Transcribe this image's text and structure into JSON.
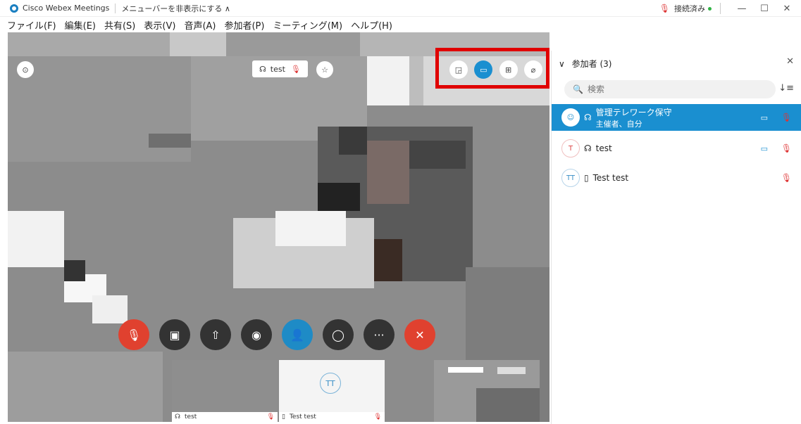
{
  "titlebar": {
    "app_title": "Cisco Webex Meetings",
    "hide_menu": "メニューバーを非表示にする ∧",
    "connection_status": "接続済み",
    "status_color": "#2fb344"
  },
  "menu": {
    "items": [
      "ファイル(F)",
      "編集(E)",
      "共有(S)",
      "表示(V)",
      "音声(A)",
      "参加者(P)",
      "ミーティング(M)",
      "ヘルプ(H)"
    ]
  },
  "stage": {
    "speaker_label": "test",
    "layout_buttons": [
      "floating",
      "stage",
      "grid",
      "pin"
    ],
    "active_layout": "stage"
  },
  "controls": {
    "items": [
      {
        "name": "mute-button",
        "icon": "mic-off-icon",
        "glyph": "🎙",
        "color": "#e0412f"
      },
      {
        "name": "video-button",
        "icon": "video-off-icon",
        "glyph": "▣",
        "color": "#333333"
      },
      {
        "name": "share-button",
        "icon": "share-icon",
        "glyph": "⇧",
        "color": "#333333"
      },
      {
        "name": "record-button",
        "icon": "record-icon",
        "glyph": "◉",
        "color": "#333333"
      },
      {
        "name": "participants-button",
        "icon": "participants-icon",
        "glyph": "👤",
        "color": "#1e8bc6"
      },
      {
        "name": "chat-button",
        "icon": "chat-icon",
        "glyph": "◯",
        "color": "#333333"
      },
      {
        "name": "more-button",
        "icon": "more-icon",
        "glyph": "···",
        "color": "#333333"
      },
      {
        "name": "leave-button",
        "icon": "close-icon",
        "glyph": "✕",
        "color": "#e0412f"
      }
    ]
  },
  "thumbnails": [
    {
      "label": "test"
    },
    {
      "label": "Test test",
      "initials": "TT"
    }
  ],
  "panel": {
    "title": "参加者 (3)",
    "search_placeholder": "検索",
    "participants": [
      {
        "name": "管理テレワーク保守",
        "role": "主催者、自分",
        "initials": "",
        "video": true,
        "muted": true
      },
      {
        "name": "test",
        "role": "",
        "initials": "T",
        "video": true,
        "muted": true
      },
      {
        "name": "Test test",
        "role": "",
        "initials": "TT",
        "video": false,
        "muted": true
      }
    ]
  },
  "colors": {
    "accent": "#1a8fd0",
    "mute_red": "#e0412f",
    "highlight": "#e00000"
  }
}
